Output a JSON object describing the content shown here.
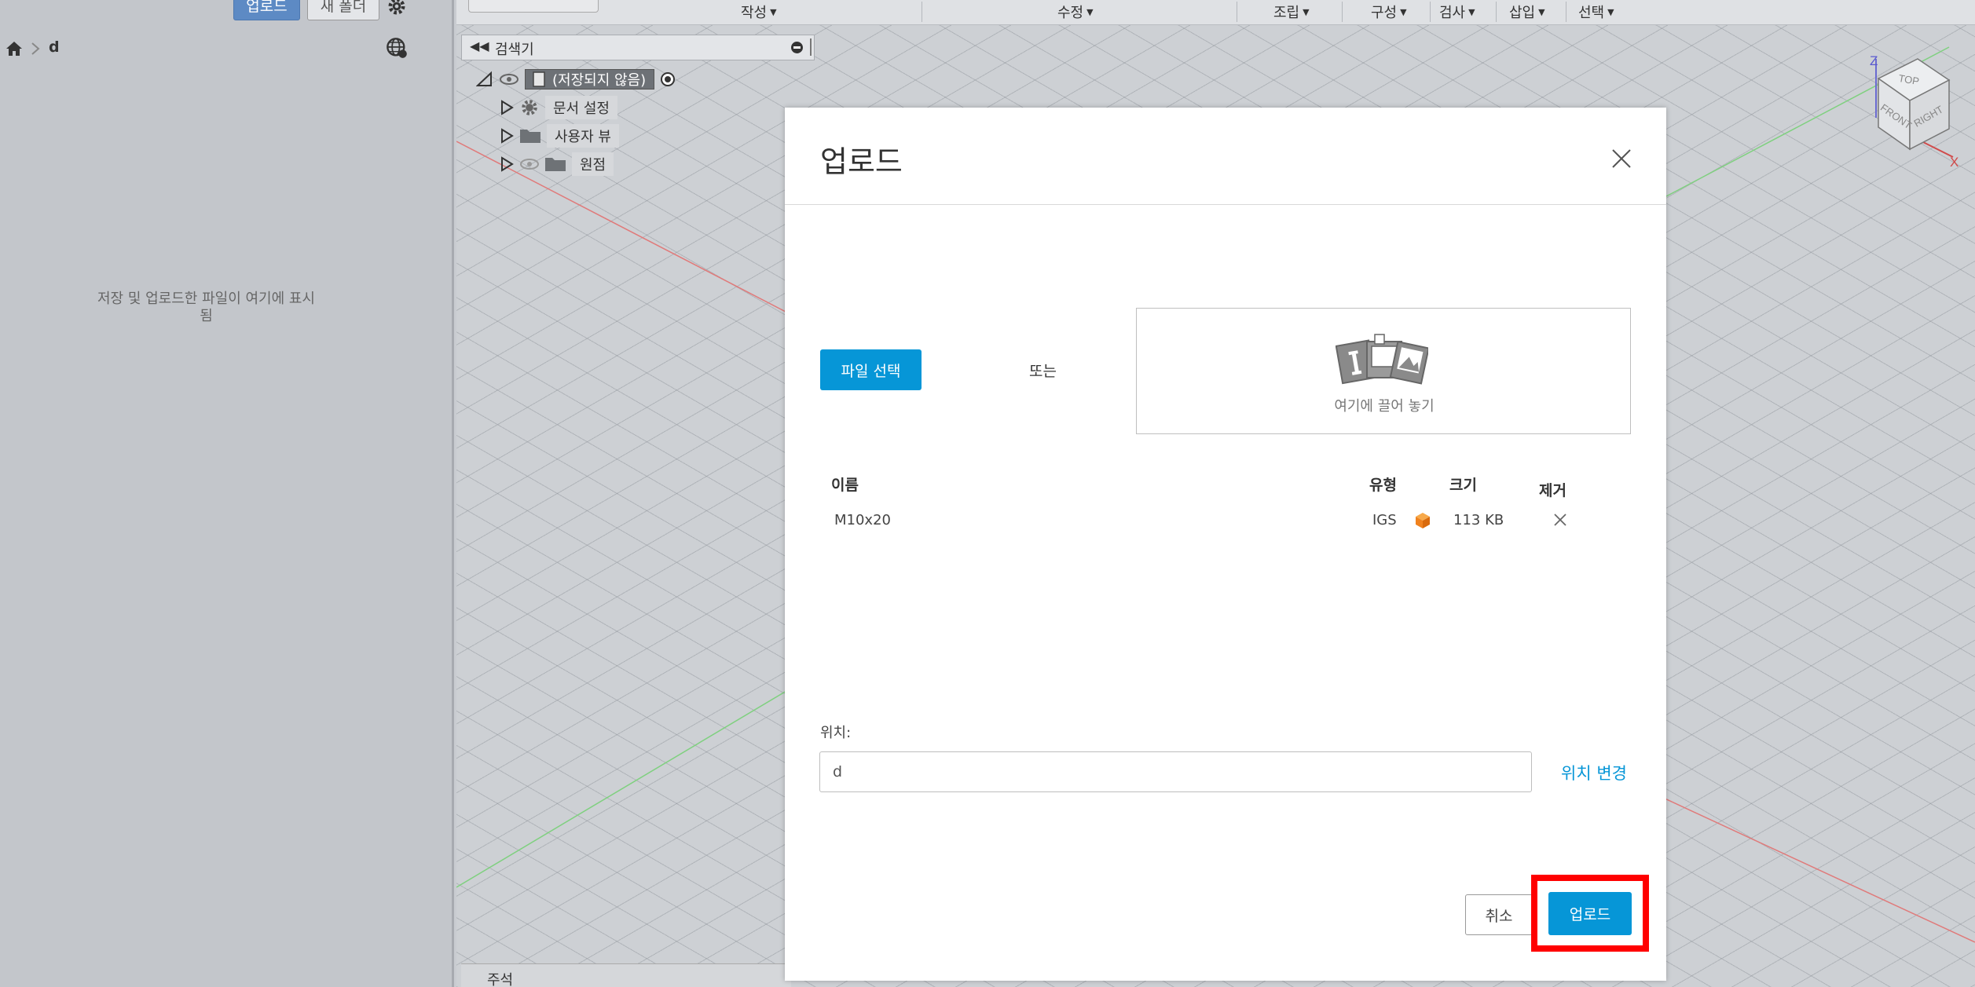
{
  "data_panel": {
    "upload_button": "업로드",
    "new_folder_button": "새 폴더",
    "breadcrumb_current": "d",
    "empty_message": "저장 및 업로드한 파일이 여기에 표시됨"
  },
  "toolbar": {
    "menus": [
      "작성",
      "수정",
      "조립",
      "구성",
      "검사",
      "삽입",
      "선택"
    ]
  },
  "browser": {
    "title": "검색기",
    "root_label": "(저장되지 않음)",
    "items": [
      "문서 설정",
      "사용자 뷰",
      "원점"
    ]
  },
  "viewcube": {
    "top": "TOP",
    "front": "FRONT",
    "right": "RIGHT",
    "axis_z": "Z",
    "axis_x": "X"
  },
  "bottom_panel": {
    "label": "주석"
  },
  "modal": {
    "title": "업로드",
    "choose_file_button": "파일 선택",
    "or_text": "또는",
    "drop_text": "여기에 끌어 놓기",
    "columns": {
      "name": "이름",
      "type": "유형",
      "size": "크기",
      "remove": "제거"
    },
    "files": [
      {
        "name": "M10x20",
        "type": "IGS",
        "size": "113 KB"
      }
    ],
    "location_label": "위치:",
    "location_value": "d",
    "change_location": "위치 변경",
    "cancel_button": "취소",
    "upload_button": "업로드"
  },
  "colors": {
    "accent": "#0696d7",
    "highlight": "#ff0000",
    "file_type_icon": "#f0821e"
  },
  "icons": [
    "gear-icon",
    "home-icon",
    "chevron-right-icon",
    "globe-icon",
    "eye-icon",
    "folder-icon",
    "close-icon",
    "drop-files-icon",
    "cube-icon"
  ]
}
